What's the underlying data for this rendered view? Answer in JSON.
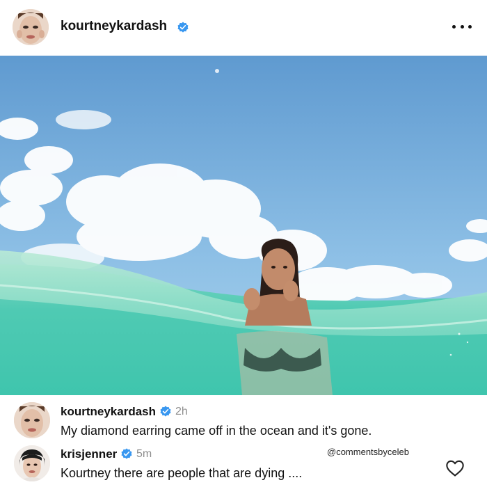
{
  "post": {
    "username": "kourtneykardash",
    "verified": true,
    "more_icon": "more-horizontal-icon"
  },
  "comments": [
    {
      "username": "kourtneykardash",
      "verified": true,
      "time": "2h",
      "text": "My diamond earring came off in the ocean and it's gone."
    },
    {
      "username": "krisjenner",
      "verified": true,
      "time": "5m",
      "text": "Kourtney there are people that are dying ....",
      "like_icon": "heart-outline-icon"
    }
  ],
  "watermark": "@commentsbyceleb",
  "colors": {
    "verified": "#3897f0",
    "sky": "#6fa6d6",
    "water": "#45c9b2",
    "muted_text": "#8e8e8e"
  }
}
